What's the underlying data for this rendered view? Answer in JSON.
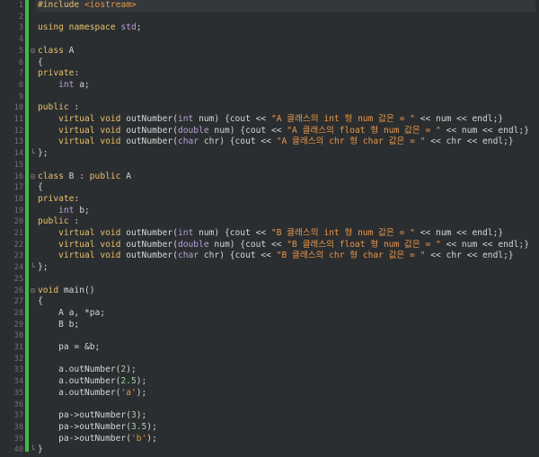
{
  "editor": {
    "lines": [
      {
        "n": "1",
        "code": "#include <iostream>"
      },
      {
        "n": "2",
        "code": ""
      },
      {
        "n": "3",
        "code": "using namespace std;"
      },
      {
        "n": "4",
        "code": ""
      },
      {
        "n": "5",
        "code": "class A"
      },
      {
        "n": "6",
        "code": "{"
      },
      {
        "n": "7",
        "code": "private:"
      },
      {
        "n": "8",
        "code": "    int a;"
      },
      {
        "n": "9",
        "code": ""
      },
      {
        "n": "10",
        "code": "public :"
      },
      {
        "n": "11",
        "code": "    virtual void outNumber(int num) {cout << \"A 클래스의 int 형 num 값은 = \" << num << endl;}"
      },
      {
        "n": "12",
        "code": "    virtual void outNumber(double num) {cout << \"A 클래스의 float 형 num 값은 = \" << num << endl;}"
      },
      {
        "n": "13",
        "code": "    virtual void outNumber(char chr) {cout << \"A 클래스의 chr 형 char 값은 = \" << chr << endl;}"
      },
      {
        "n": "14",
        "code": "};"
      },
      {
        "n": "15",
        "code": ""
      },
      {
        "n": "16",
        "code": "class B : public A"
      },
      {
        "n": "17",
        "code": "{"
      },
      {
        "n": "18",
        "code": "private:"
      },
      {
        "n": "19",
        "code": "    int b;"
      },
      {
        "n": "20",
        "code": "public :"
      },
      {
        "n": "21",
        "code": "    virtual void outNumber(int num) {cout << \"B 클래스의 int 형 num 값은 = \" << num << endl;}"
      },
      {
        "n": "22",
        "code": "    virtual void outNumber(double num) {cout << \"B 클래스의 float 형 num 값은 = \" << num << endl;}"
      },
      {
        "n": "23",
        "code": "    virtual void outNumber(char chr) {cout << \"B 클래스의 chr 형 char 값은 = \" << chr << endl;}"
      },
      {
        "n": "24",
        "code": "};"
      },
      {
        "n": "25",
        "code": ""
      },
      {
        "n": "26",
        "code": "void main()"
      },
      {
        "n": "27",
        "code": "{"
      },
      {
        "n": "28",
        "code": "    A a, *pa;"
      },
      {
        "n": "29",
        "code": "    B b;"
      },
      {
        "n": "30",
        "code": ""
      },
      {
        "n": "31",
        "code": "    pa = &b;"
      },
      {
        "n": "32",
        "code": ""
      },
      {
        "n": "33",
        "code": "    a.outNumber(2);"
      },
      {
        "n": "34",
        "code": "    a.outNumber(2.5);"
      },
      {
        "n": "35",
        "code": "    a.outNumber('a');"
      },
      {
        "n": "36",
        "code": ""
      },
      {
        "n": "37",
        "code": "    pa->outNumber(3);"
      },
      {
        "n": "38",
        "code": "    pa->outNumber(3.5);"
      },
      {
        "n": "39",
        "code": "    pa->outNumber('b');"
      },
      {
        "n": "40",
        "code": "}"
      }
    ],
    "fold_markers": {
      "5": "⊟",
      "14": "└",
      "16": "⊟",
      "24": "└",
      "26": "⊟",
      "40": "└"
    },
    "colors": {
      "background": "#2b2e30",
      "line_number": "#6d7378",
      "change_bar": "#3fbd4a",
      "text": "#d6d6d6",
      "keyword": "#e8c06a",
      "type": "#b9a0d8",
      "string": "#e7974a",
      "number": "#9fd3a1"
    }
  }
}
